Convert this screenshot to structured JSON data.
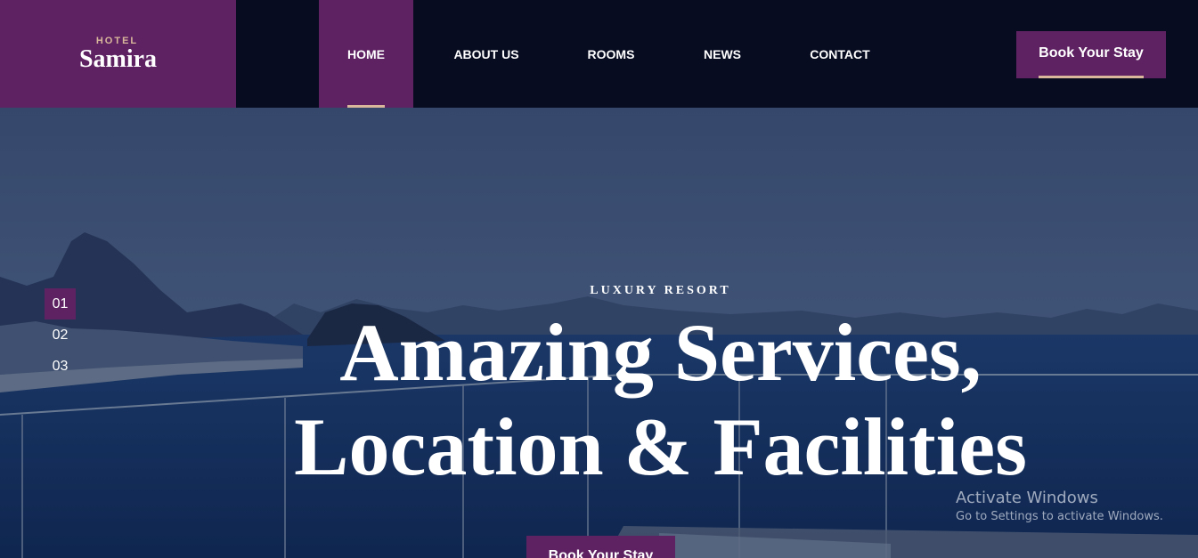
{
  "logo": {
    "small": "HOTEL",
    "name": "Samira"
  },
  "nav": {
    "home": "HOME",
    "about": "ABOUT US",
    "rooms": "ROOMS",
    "news": "NEWS",
    "contact": "CONTACT"
  },
  "header_cta": "Book Your Stay",
  "hero": {
    "eyebrow": "LUXURY RESORT",
    "line1": "Amazing Services,",
    "line2": "Location & Facilities",
    "cta": "Book Your Stay",
    "slides": [
      "01",
      "02",
      "03"
    ],
    "active_slide": "01"
  },
  "watermark": {
    "title": "Activate Windows",
    "subtitle": "Go to Settings to activate Windows."
  },
  "colors": {
    "brand_purple": "#5e2263",
    "header_bg": "#070c21",
    "accent_tan": "#d8b79a"
  }
}
